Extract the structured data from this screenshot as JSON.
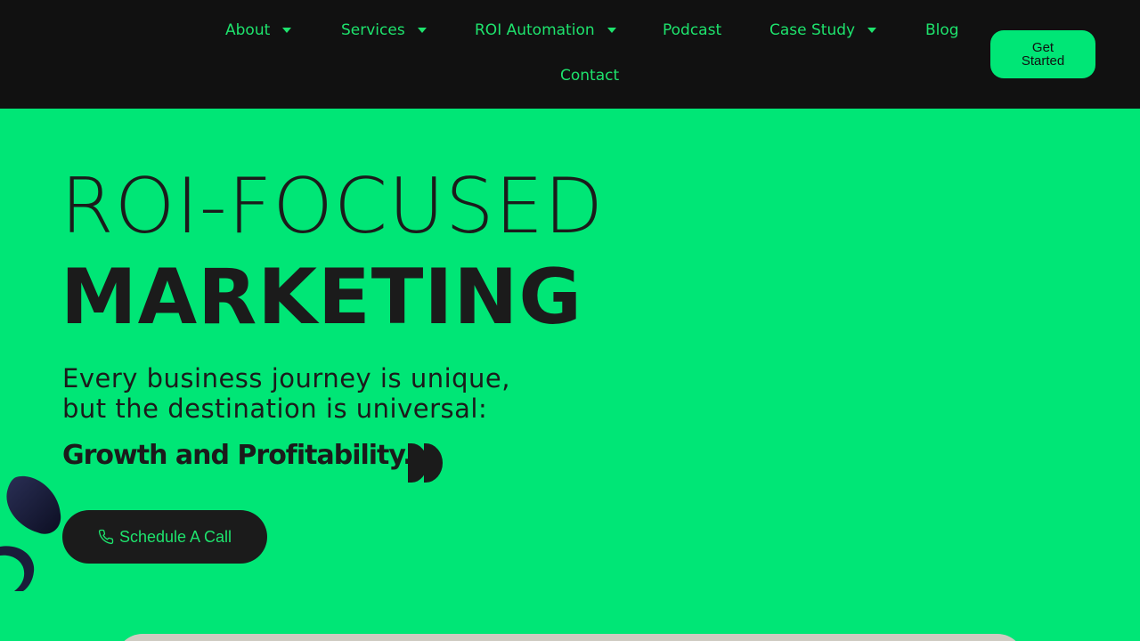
{
  "nav": {
    "items": [
      {
        "label": "About",
        "has_dropdown": true
      },
      {
        "label": "Services",
        "has_dropdown": true
      },
      {
        "label": "ROI Automation",
        "has_dropdown": true
      },
      {
        "label": "Podcast",
        "has_dropdown": false
      },
      {
        "label": "Case Study",
        "has_dropdown": true
      },
      {
        "label": "Blog",
        "has_dropdown": false
      },
      {
        "label": "Contact",
        "has_dropdown": false
      }
    ],
    "cta_line1": "Get",
    "cta_line2": "Started"
  },
  "hero": {
    "title_line1": "ROI-FOCUSED",
    "title_line2": "MARKETING",
    "subtitle_line1": "Every business journey is unique,",
    "subtitle_line2": "but the destination is universal:",
    "tagline": "Growth and Profitability.",
    "schedule_label": "Schedule A Call"
  },
  "colors": {
    "background": "#00e676",
    "header": "#111111",
    "accent_text": "#1ee36d",
    "dark_text": "#1b1b1b"
  },
  "icons": {
    "caret": "caret-down-icon",
    "phone": "phone-icon",
    "brand_mark": "double-d-logo-icon"
  }
}
